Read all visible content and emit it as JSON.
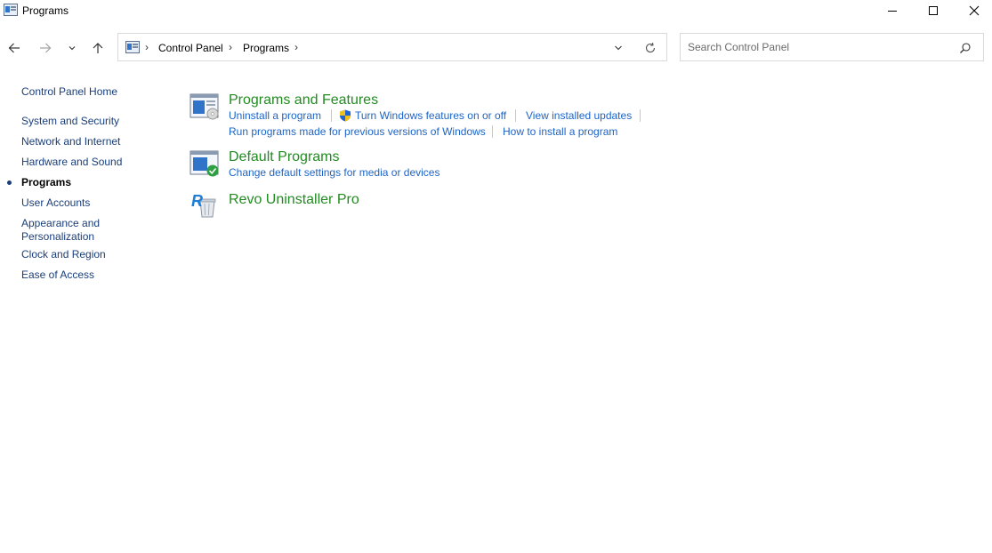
{
  "window": {
    "title": "Programs",
    "icons": {
      "app": "control-panel-icon",
      "minimize": "minimize-icon",
      "maximize": "maximize-icon",
      "close": "close-icon"
    }
  },
  "nav": {
    "icons": {
      "back": "back-arrow-icon",
      "forward": "forward-arrow-icon",
      "recent": "chevron-down-icon",
      "up": "up-arrow-icon"
    }
  },
  "address": {
    "breadcrumbs": [
      "Control Panel",
      "Programs"
    ],
    "icons": {
      "location": "control-panel-icon",
      "separator": "chevron-right-icon",
      "dropdown": "chevron-down-icon",
      "refresh": "refresh-icon"
    }
  },
  "search": {
    "placeholder": "Search Control Panel",
    "value": "",
    "icon": "search-icon"
  },
  "sidebar": {
    "home": "Control Panel Home",
    "items": [
      {
        "label": "System and Security"
      },
      {
        "label": "Network and Internet"
      },
      {
        "label": "Hardware and Sound"
      },
      {
        "label": "Programs",
        "active": true
      },
      {
        "label": "User Accounts"
      },
      {
        "label": "Appearance and",
        "label_line2": "Personalization"
      },
      {
        "label": "Clock and Region"
      },
      {
        "label": "Ease of Access"
      }
    ]
  },
  "categories": [
    {
      "title": "Programs and Features",
      "icon": "programs-and-features-icon",
      "tasks_row1": [
        "Uninstall a program",
        "Turn Windows features on or off",
        "View installed updates"
      ],
      "tasks_row2": [
        "Run programs made for previous versions of Windows",
        "How to install a program"
      ],
      "shield_icon": "uac-shield-icon"
    },
    {
      "title": "Default Programs",
      "icon": "default-programs-icon",
      "tasks_row1": [
        "Change default settings for media or devices"
      ]
    },
    {
      "title": "Revo Uninstaller Pro",
      "icon": "revo-uninstaller-icon"
    }
  ],
  "colors": {
    "link": "#1c64c8",
    "category_title": "#228b22",
    "sidebar_link": "#1a3e7a"
  }
}
